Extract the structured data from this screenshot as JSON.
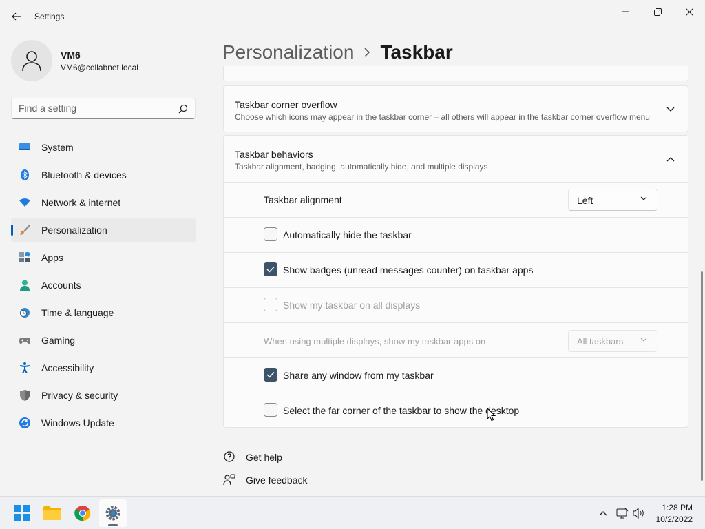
{
  "window": {
    "title": "Settings"
  },
  "profile": {
    "name": "VM6",
    "email": "VM6@collabnet.local"
  },
  "search": {
    "placeholder": "Find a setting"
  },
  "sidebar": {
    "items": [
      {
        "label": "System",
        "icon": "monitor-icon",
        "color": "#0078d4"
      },
      {
        "label": "Bluetooth & devices",
        "icon": "bluetooth-icon",
        "color": "#0078d4"
      },
      {
        "label": "Network & internet",
        "icon": "wifi-icon",
        "color": "#0078d4"
      },
      {
        "label": "Personalization",
        "icon": "paintbrush-icon",
        "color": "#c46a2a",
        "active": true
      },
      {
        "label": "Apps",
        "icon": "apps-icon",
        "color": "#5a6a7a"
      },
      {
        "label": "Accounts",
        "icon": "person-icon",
        "color": "#2aa198"
      },
      {
        "label": "Time & language",
        "icon": "globe-clock-icon",
        "color": "#0078d4"
      },
      {
        "label": "Gaming",
        "icon": "gamepad-icon",
        "color": "#6b6b6b"
      },
      {
        "label": "Accessibility",
        "icon": "accessibility-icon",
        "color": "#0067c0"
      },
      {
        "label": "Privacy & security",
        "icon": "shield-icon",
        "color": "#7a7a7a"
      },
      {
        "label": "Windows Update",
        "icon": "update-icon",
        "color": "#0078d4"
      }
    ]
  },
  "header": {
    "parent": "Personalization",
    "separator": "›",
    "current": "Taskbar"
  },
  "sections": {
    "overflow": {
      "title": "Taskbar corner overflow",
      "description": "Choose which icons may appear in the taskbar corner – all others will appear in the taskbar corner overflow menu"
    },
    "behaviors": {
      "title": "Taskbar behaviors",
      "description": "Taskbar alignment, badging, automatically hide, and multiple displays",
      "alignment": {
        "label": "Taskbar alignment",
        "value": "Left"
      },
      "auto_hide": {
        "label": "Automatically hide the taskbar",
        "checked": false
      },
      "badges": {
        "label": "Show badges (unread messages counter) on taskbar apps",
        "checked": true
      },
      "all_displays": {
        "label": "Show my taskbar on all displays",
        "checked": false,
        "disabled": true
      },
      "multi_display": {
        "label": "When using multiple displays, show my taskbar apps on",
        "value": "All taskbars",
        "disabled": true
      },
      "share_window": {
        "label": "Share any window from my taskbar",
        "checked": true
      },
      "far_corner": {
        "label": "Select the far corner of the taskbar to show the desktop",
        "checked": false
      }
    }
  },
  "footer": {
    "help": "Get help",
    "feedback": "Give feedback"
  },
  "taskbar": {
    "apps": [
      "start-icon",
      "file-explorer-icon",
      "chrome-icon",
      "settings-icon"
    ],
    "time": "1:28 PM",
    "date": "10/2/2022"
  },
  "colors": {
    "accent": "#005fb8",
    "checkbox_checked": "#3c5368"
  }
}
